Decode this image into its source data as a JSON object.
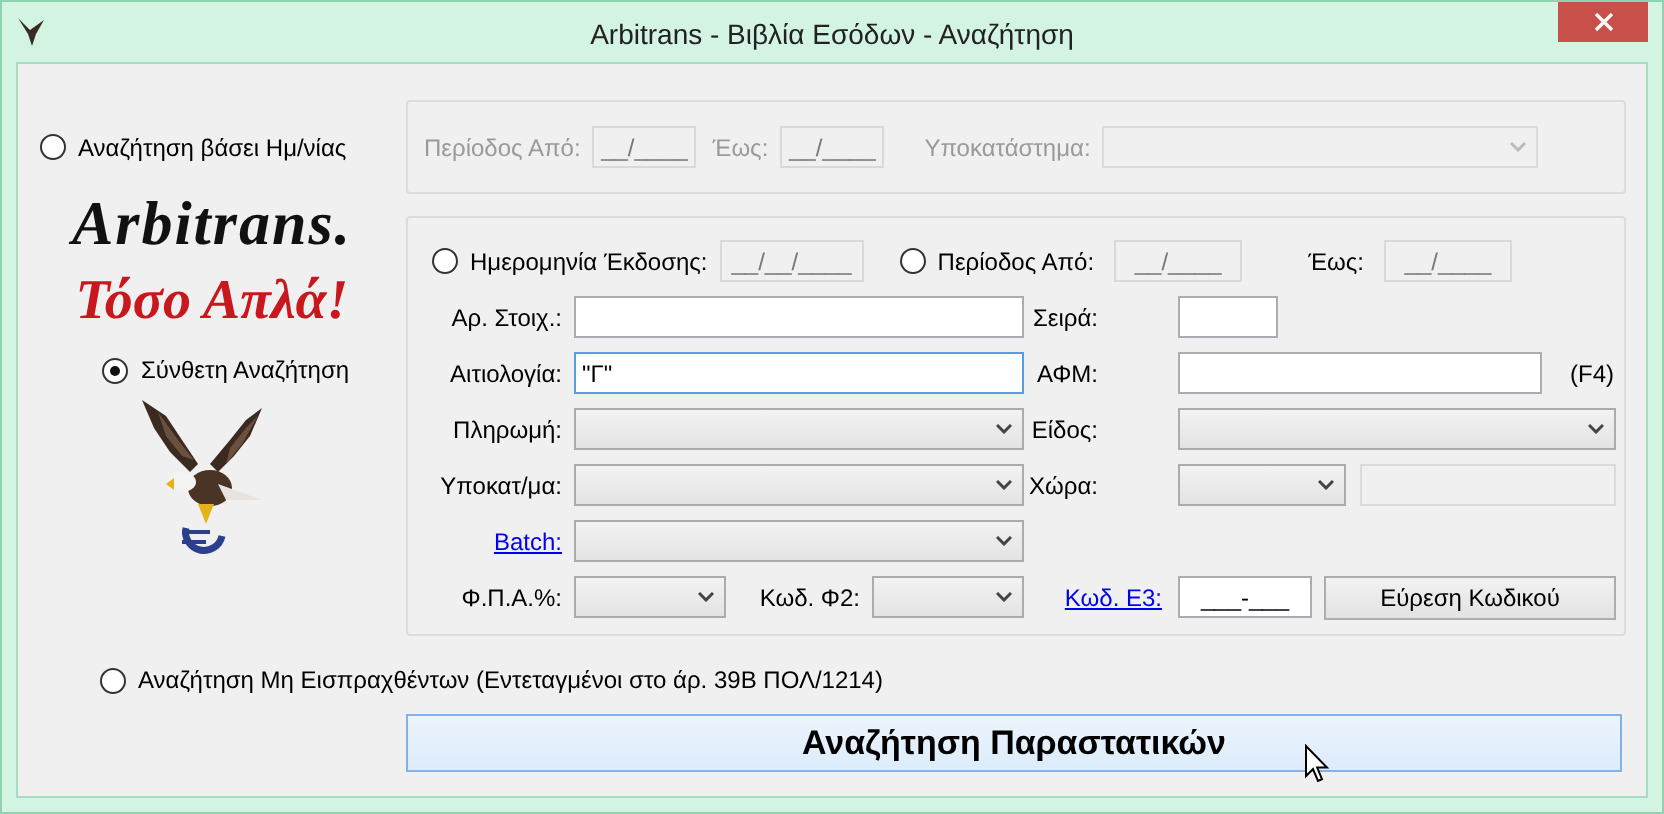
{
  "window": {
    "title": "Arbitrans - Βιβλία Εσόδων - Αναζήτηση"
  },
  "date_search": {
    "label": "Αναζήτηση βάσει Ημ/νίας",
    "selected": false,
    "period_from_label": "Περίοδος Από:",
    "period_from": "__/____",
    "to_label": "Έως:",
    "to": "__/____",
    "branch_label": "Υποκατάστημα:"
  },
  "logo": {
    "name": "Arbitrans.",
    "slogan": "Τόσο Απλά!"
  },
  "advanced_search": {
    "label": "Σύνθετη Αναζήτηση",
    "selected": true
  },
  "advanced": {
    "issue_date": {
      "label": "Ημερομηνία Έκδοσης:",
      "selected": false,
      "value": "__/__/____"
    },
    "period": {
      "label": "Περίοδος Από:",
      "selected": false,
      "from": "__/____",
      "to_label": "Έως:",
      "to": "__/____"
    },
    "doc_number": {
      "label": "Αρ. Στοιχ.:"
    },
    "series": {
      "label": "Σειρά:"
    },
    "reason": {
      "label": "Αιτιολογία:",
      "value": "\"Γ\"",
      "focused": true
    },
    "vat_number": {
      "label": "ΑΦΜ:",
      "hint": "(F4)"
    },
    "payment": {
      "label": "Πληρωμή:"
    },
    "type": {
      "label": "Είδος:"
    },
    "branch": {
      "label": "Υποκατ/μα:"
    },
    "country": {
      "label": "Χώρα:"
    },
    "batch": {
      "label": "Batch:"
    },
    "vat_rate": {
      "label": "Φ.Π.Α.%:"
    },
    "code_f2": {
      "label": "Κωδ. Φ2:"
    },
    "code_e3": {
      "label": "Κωδ. Ε3:",
      "value": "___-___"
    },
    "find_code_button": "Εύρεση Κωδικού"
  },
  "uncollected_search": {
    "label": "Αναζήτηση Μη Εισπραχθέντων (Εντεταγμένοι στο άρ. 39Β ΠΟΛ/1214)",
    "selected": false
  },
  "search_button": "Αναζήτηση Παραστατικών"
}
